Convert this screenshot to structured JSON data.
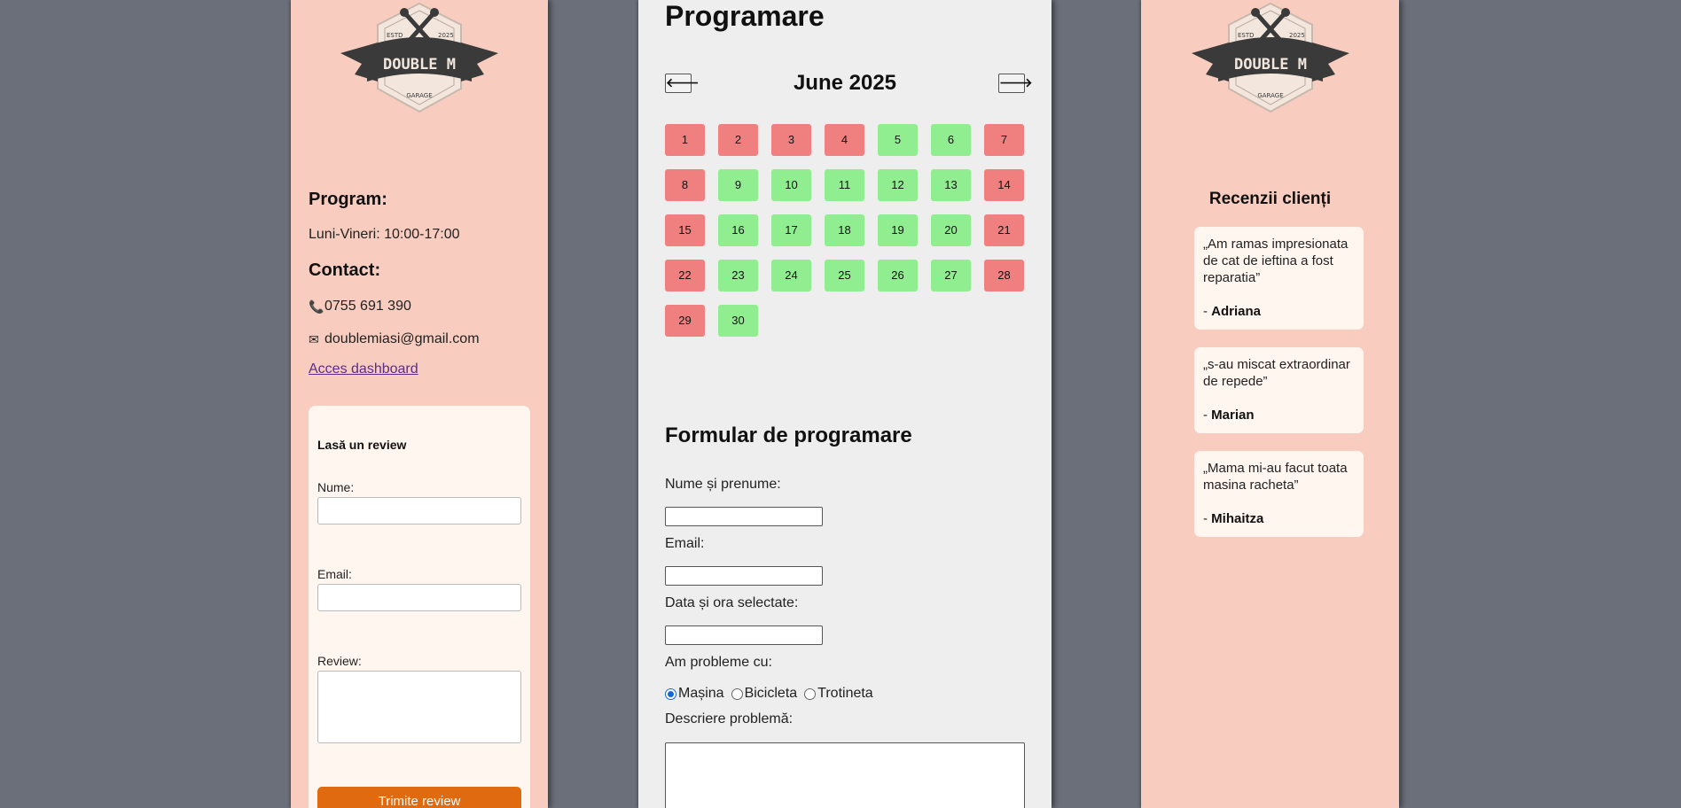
{
  "brand": {
    "logo_top_left": "ESTD",
    "logo_top_right": "2025",
    "logo_name": "DOUBLE M",
    "logo_sub": "GARAGE"
  },
  "left": {
    "program_heading": "Program:",
    "program_hours": "Luni-Vineri: 10:00-17:00",
    "contact_heading": "Contact:",
    "phone": "0755 691 390",
    "email": "doublemiasi@gmail.com",
    "dashboard_link": "Acces dashboard",
    "icons": {
      "phone": "phone-icon",
      "email": "envelope-icon"
    }
  },
  "review_form": {
    "title": "Lasă un review",
    "name_label": "Nume:",
    "email_label": "Email:",
    "review_label": "Review:",
    "submit_label": "Trimite review"
  },
  "calendar": {
    "title": "Programare",
    "month_label": "June 2025",
    "prev_label": "🡐",
    "next_label": "🡒",
    "days": [
      {
        "d": "1",
        "s": "busy"
      },
      {
        "d": "2",
        "s": "busy"
      },
      {
        "d": "3",
        "s": "busy"
      },
      {
        "d": "4",
        "s": "busy"
      },
      {
        "d": "5",
        "s": "free"
      },
      {
        "d": "6",
        "s": "free"
      },
      {
        "d": "7",
        "s": "busy"
      },
      {
        "d": "8",
        "s": "busy"
      },
      {
        "d": "9",
        "s": "free"
      },
      {
        "d": "10",
        "s": "free"
      },
      {
        "d": "11",
        "s": "free"
      },
      {
        "d": "12",
        "s": "free"
      },
      {
        "d": "13",
        "s": "free"
      },
      {
        "d": "14",
        "s": "busy"
      },
      {
        "d": "15",
        "s": "busy"
      },
      {
        "d": "16",
        "s": "free"
      },
      {
        "d": "17",
        "s": "free"
      },
      {
        "d": "18",
        "s": "free"
      },
      {
        "d": "19",
        "s": "free"
      },
      {
        "d": "20",
        "s": "free"
      },
      {
        "d": "21",
        "s": "busy"
      },
      {
        "d": "22",
        "s": "busy"
      },
      {
        "d": "23",
        "s": "free"
      },
      {
        "d": "24",
        "s": "free"
      },
      {
        "d": "25",
        "s": "free"
      },
      {
        "d": "26",
        "s": "free"
      },
      {
        "d": "27",
        "s": "free"
      },
      {
        "d": "28",
        "s": "busy"
      },
      {
        "d": "29",
        "s": "busy"
      },
      {
        "d": "30",
        "s": "free"
      }
    ],
    "colors": {
      "busy": "#f08080",
      "free": "#90ee90"
    }
  },
  "booking_form": {
    "title": "Formular de programare",
    "name_label": "Nume și prenume:",
    "email_label": "Email:",
    "datetime_label": "Data și ora selectate:",
    "problem_label": "Am probleme cu:",
    "options": [
      "Mașina",
      "Bicicleta",
      "Trotineta"
    ],
    "selected_option": "Mașina",
    "description_label": "Descriere problemă:"
  },
  "reviews": {
    "title": "Recenzii clienți",
    "items": [
      {
        "text": "„Am ramas impresionata de cat de ieftina a fost reparatia”",
        "author": "Adriana"
      },
      {
        "text": "„s-au miscat extraordinar de repede”",
        "author": "Marian"
      },
      {
        "text": "„Mama mi-au facut toata masina racheta”",
        "author": "Mihaitza"
      }
    ]
  },
  "theme": {
    "background": "#6b6f79",
    "side_panel": "#f8cdbf",
    "center_panel": "#eeeeee",
    "accent_button": "#e06a10"
  }
}
